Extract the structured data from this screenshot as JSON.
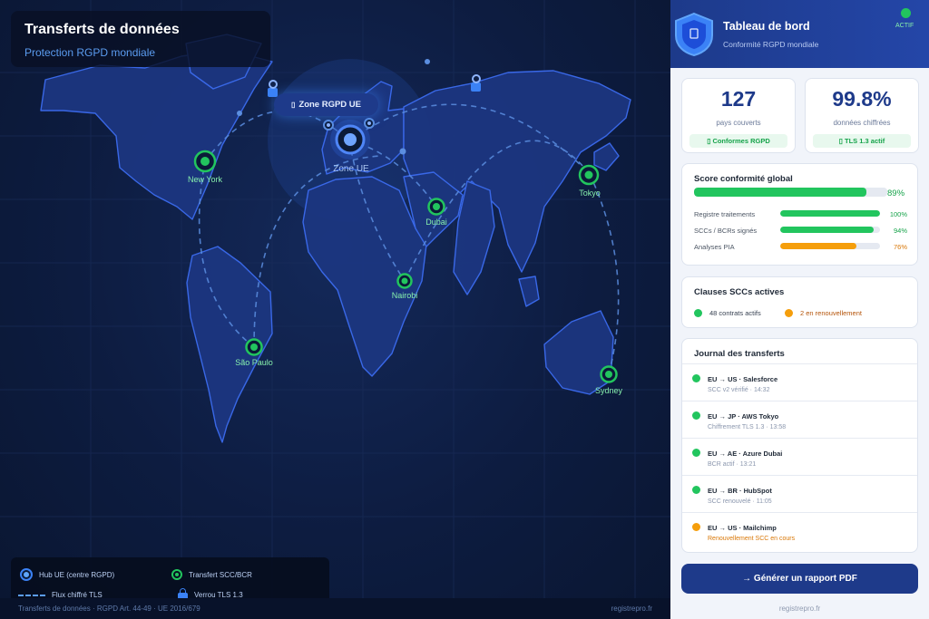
{
  "map": {
    "title": "Transferts de données",
    "subtitle": "Protection RGPD mondiale",
    "zone_pill": "Zone RGPD UE",
    "zone_pill_icon": "shield-icon",
    "hub_label": "Zone UE",
    "cities": [
      "New York",
      "Tokyo",
      "Dubai",
      "Nairobi",
      "São Paulo",
      "Sydney"
    ]
  },
  "legend": {
    "hub": "Hub UE (centre RGPD)",
    "scc": "Transfert SCC/BCR",
    "flow": "Flux chiffré TLS",
    "lock": "Verrou TLS 1.3"
  },
  "footer": {
    "left": "Transferts de données · RGPD Art. 44-49 · UE 2016/679",
    "right": "registrepro.fr"
  },
  "panel": {
    "title": "Tableau de bord",
    "subtitle": "Conformité RGPD mondiale",
    "status": "ACTIF",
    "shield_icon": "shield-icon"
  },
  "stats": [
    {
      "value": "127",
      "label": "pays couverts",
      "badge": "Conformes RGPD"
    },
    {
      "value": "99.8%",
      "label": "données chiffrées",
      "badge": "TLS 1.3 actif"
    }
  ],
  "score": {
    "title": "Score conformité global",
    "value": 89,
    "value_text": "89%",
    "items": [
      {
        "name": "Registre traitements",
        "pct": 100,
        "pct_text": "100%",
        "color": "#22c55e"
      },
      {
        "name": "SCCs / BCRs signés",
        "pct": 94,
        "pct_text": "94%",
        "color": "#22c55e"
      },
      {
        "name": "Analyses PIA",
        "pct": 76,
        "pct_text": "76%",
        "color": "#f59e0b"
      }
    ]
  },
  "clauses": {
    "title": "Clauses SCCs actives",
    "active": "48 contrats actifs",
    "renewal": "2 en renouvellement"
  },
  "journal": {
    "title": "Journal des transferts",
    "rows": [
      {
        "title": "EU → US · Salesforce",
        "sub": "SCC v2 vérifié · 14:32",
        "status": "ok"
      },
      {
        "title": "EU → JP · AWS Tokyo",
        "sub": "Chiffrement TLS 1.3 · 13:58",
        "status": "ok"
      },
      {
        "title": "EU → AE · Azure Dubai",
        "sub": "BCR actif · 13:21",
        "status": "ok"
      },
      {
        "title": "EU → BR · HubSpot",
        "sub": "SCC renouvelé · 11:05",
        "status": "ok"
      },
      {
        "title": "EU → US · Mailchimp",
        "sub": "Renouvellement SCC en cours",
        "status": "warn"
      }
    ]
  },
  "actions": {
    "generate": "→ Générer un rapport PDF"
  },
  "panel_footer": "registrepro.fr",
  "colors": {
    "accent": "#1e3a8a",
    "ok": "#22c55e",
    "warn": "#f59e0b"
  }
}
